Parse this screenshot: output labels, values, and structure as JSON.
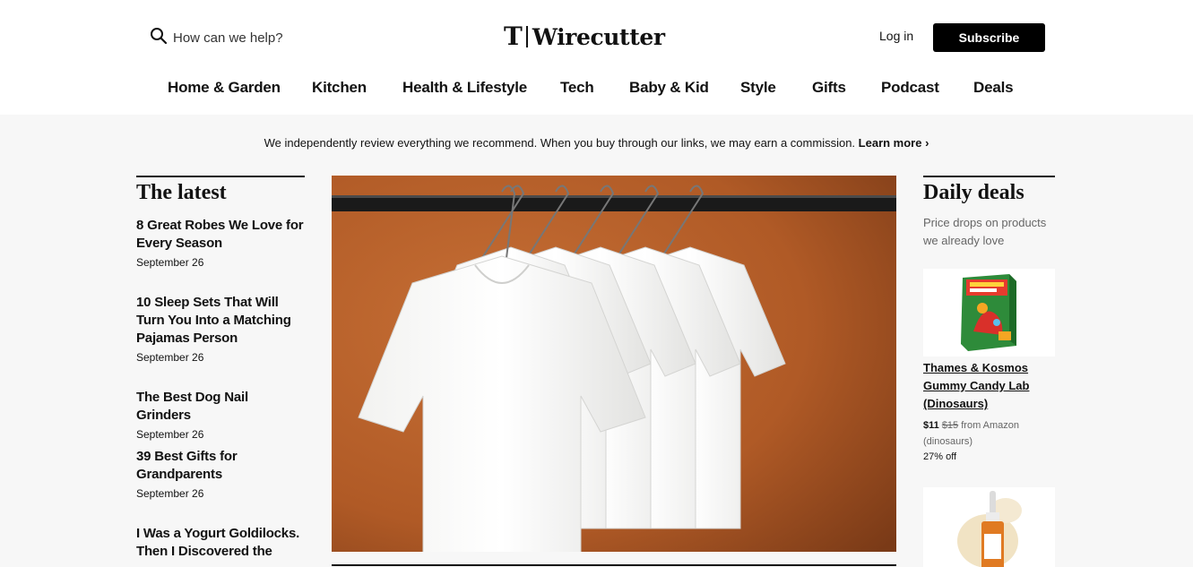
{
  "header": {
    "search_placeholder": "How can we help?",
    "logo_mark": "T",
    "logo_text": "Wirecutter",
    "login_label": "Log in",
    "subscribe_label": "Subscribe"
  },
  "nav": {
    "items": [
      "Home & Garden",
      "Kitchen",
      "Health & Lifestyle",
      "Tech",
      "Baby & Kid",
      "Style",
      "Gifts",
      "Podcast",
      "Deals"
    ]
  },
  "disclosure": {
    "text": "We independently review everything we recommend. When you buy through our links, we may earn a commission.",
    "link_label": "Learn more ›"
  },
  "latest": {
    "title": "The latest",
    "articles": [
      {
        "title": "8 Great Robes We Love for Every Season",
        "date": "September 26"
      },
      {
        "title": "10 Sleep Sets That Will Turn You Into a Matching Pajamas Person",
        "date": "September 26"
      },
      {
        "title": "The Best Dog Nail Grinders",
        "date": "September 26"
      },
      {
        "title": "39 Best Gifts for Grandparents",
        "date": "September 26"
      },
      {
        "title": "I Was a Yogurt Goldilocks. Then I Discovered the",
        "date": ""
      }
    ]
  },
  "hero": {
    "image": "white-tshirts-on-hangers",
    "background_color": "#b8642f"
  },
  "deals": {
    "title": "Daily deals",
    "subtitle": "Price drops on products we already love",
    "items": [
      {
        "name": "Thames & Kosmos Gummy Candy Lab (Dinosaurs)",
        "price": "$11",
        "was": "$15",
        "source": "from Amazon",
        "variant": "(dinosaurs)",
        "discount": "27% off",
        "image": "gummy-candy-lab-box"
      },
      {
        "image": "serum-dropper-bottle"
      }
    ]
  },
  "colors": {
    "accent": "#000000",
    "text": "#121212",
    "muted": "#666666",
    "page_bg": "#f7f7f7"
  }
}
